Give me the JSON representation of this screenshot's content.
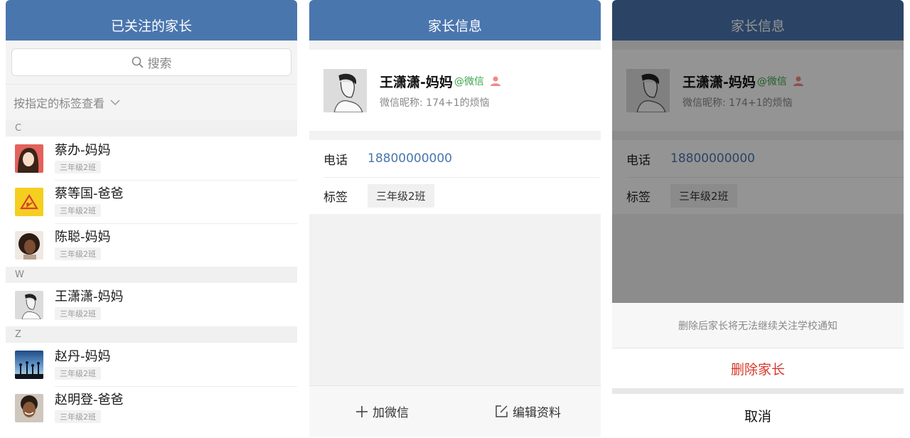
{
  "list_screen": {
    "title": "已关注的家长",
    "search_placeholder": "搜索",
    "filter_label": "按指定的标签查看",
    "sections": [
      {
        "letter": "C",
        "contacts": [
          {
            "name": "蔡办-妈妈",
            "tag": "三年级2班",
            "avatar": "anime-girl-avatar"
          },
          {
            "name": "蔡等国-爸爸",
            "tag": "三年级2班",
            "avatar": "yellow-warning-sign-avatar"
          },
          {
            "name": "陈聪-妈妈",
            "tag": "三年级2班",
            "avatar": "curly-hair-woman-avatar"
          }
        ]
      },
      {
        "letter": "W",
        "contacts": [
          {
            "name": "王潇潇-妈妈",
            "tag": "三年级2班",
            "avatar": "sketch-man-avatar"
          }
        ]
      },
      {
        "letter": "Z",
        "contacts": [
          {
            "name": "赵丹-妈妈",
            "tag": "三年级2班",
            "avatar": "sunset-silhouettes-avatar"
          },
          {
            "name": "赵明登-爸爸",
            "tag": "三年级2班",
            "avatar": "smiling-man-avatar"
          }
        ]
      }
    ]
  },
  "detail_screen": {
    "title": "家长信息",
    "profile": {
      "name": "王潇潇-妈妈",
      "source": "@微信",
      "nickname": "微信昵称: 174+1的烦恼"
    },
    "phone_label": "电话",
    "phone_value": "18800000000",
    "tag_label": "标签",
    "tag_value": "三年级2班",
    "add_wechat": "加微信",
    "edit_profile": "编辑资料"
  },
  "action_sheet": {
    "hint": "删除后家长将无法继续关注学校通知",
    "delete_label": "删除家长",
    "cancel_label": "取消"
  },
  "colors": {
    "header": "#4a76ae",
    "wechat_green": "#3ea64e",
    "danger_red": "#d9372b",
    "link_blue": "#4a76ae"
  }
}
